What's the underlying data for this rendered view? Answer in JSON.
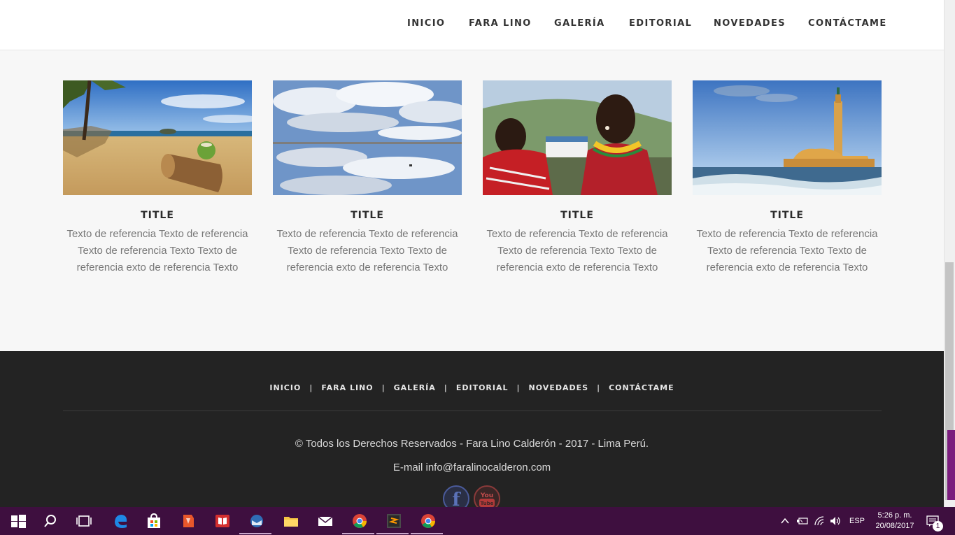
{
  "nav": {
    "items": [
      "INICIO",
      "FARA LINO",
      "GALERÍA",
      "EDITORIAL",
      "NOVEDADES",
      "CONTÁCTAME"
    ]
  },
  "cards": [
    {
      "title": "TITLE",
      "text": "Texto de referencia Texto de referencia Texto de referencia Texto Texto de referencia exto de referencia Texto",
      "image": "beach-with-coconut"
    },
    {
      "title": "TITLE",
      "text": "Texto de referencia Texto de referencia Texto de referencia Texto Texto de referencia exto de referencia Texto",
      "image": "salt-flat-reflection"
    },
    {
      "title": "TITLE",
      "text": "Texto de referencia Texto de referencia Texto de referencia Texto Texto de referencia exto de referencia Texto",
      "image": "maasai-women"
    },
    {
      "title": "TITLE",
      "text": "Texto de referencia Texto de referencia Texto de referencia Texto Texto de referencia exto de referencia Texto",
      "image": "mosque-by-sea"
    }
  ],
  "footer": {
    "nav": [
      "INICIO",
      "FARA LINO",
      "GALERÍA",
      "EDITORIAL",
      "NOVEDADES",
      "CONTÁCTAME"
    ],
    "separator": "|",
    "copyright": "© Todos los Derechos Reservados - Fara Lino Calderón - 2017 - Lima Perú.",
    "email": "E-mail info@faralinocalderon.com",
    "social": {
      "facebook_letter": "f",
      "youtube_top": "You",
      "youtube_bottom": "Tube"
    }
  },
  "taskbar": {
    "language": "ESP",
    "time": "5:26 p. m.",
    "date": "20/08/2017",
    "notifications": "1",
    "apps": [
      "windows-start-icon",
      "search-icon",
      "task-view-icon",
      "edge-icon",
      "store-icon",
      "app-orange-icon",
      "reader-icon",
      "thunderbird-icon",
      "file-explorer-icon",
      "mail-icon",
      "chrome-icon",
      "sublime-icon",
      "chrome-icon"
    ]
  },
  "colors": {
    "accent": "#7b1d7e",
    "taskbar": "#3e0f3f",
    "footer": "#232323"
  }
}
